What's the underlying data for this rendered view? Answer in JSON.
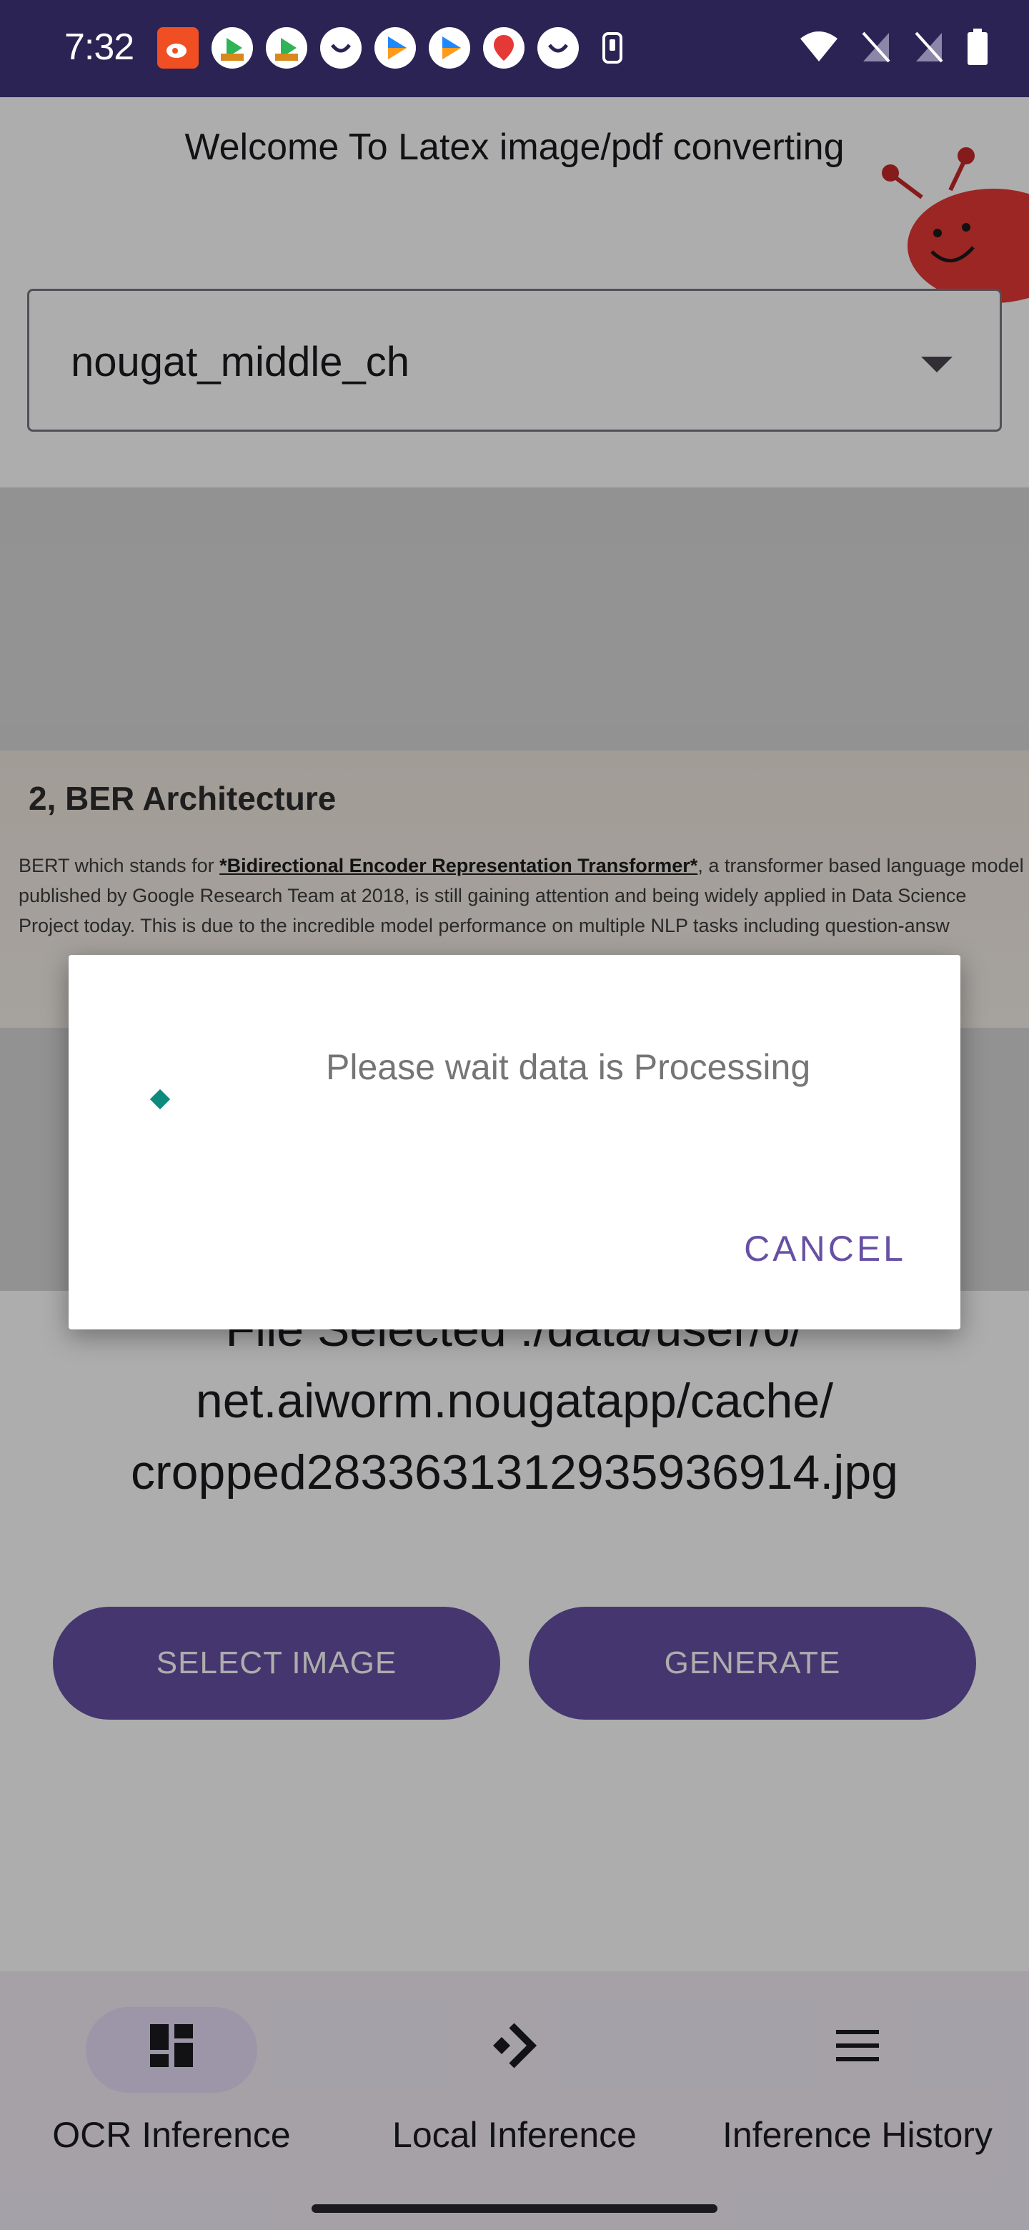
{
  "status_bar": {
    "time": "7:32",
    "notification_icons": [
      "weibo-icon",
      "video-app-icon",
      "video-app-icon",
      "taobao-icon",
      "play-app-icon",
      "play-app-icon",
      "map-pin-icon",
      "taobao-icon",
      "phone-icon"
    ],
    "system_icons": [
      "wifi-icon",
      "no-sim-icon",
      "no-sim-icon",
      "battery-icon"
    ]
  },
  "app": {
    "title": "Welcome To Latex image/pdf converting",
    "model_dropdown": {
      "value": "nougat_middle_ch"
    },
    "document_preview": {
      "heading": "2, BER Architecture",
      "text_before": "BERT which stands for ",
      "text_bold": "*Bidirectional Encoder Representation Transformer*",
      "text_after": ", a transformer based language model published by Google Research Team at 2018, is still gaining attention and being widely applied in Data Science Project today. This is due to the incredible model performance on multiple NLP tasks including question-answ"
    },
    "file_selected": "File Selected :/data/user/0/ net.aiworm.nougatapp/cache/ cropped2833631312935936914.jpg",
    "buttons": {
      "select_image": "SELECT IMAGE",
      "generate": "GENERATE"
    }
  },
  "bottom_nav": {
    "items": [
      {
        "label": "OCR Inference",
        "icon": "dashboard-icon",
        "active": true
      },
      {
        "label": "Local Inference",
        "icon": "arrow-right-icon",
        "active": false
      },
      {
        "label": "Inference History",
        "icon": "menu-icon",
        "active": false
      }
    ]
  },
  "dialog": {
    "message": "Please wait data is Processing",
    "cancel_label": "CANCEL"
  },
  "colors": {
    "status_bar": "#2b2354",
    "primary": "#6750a4",
    "spinner": "#0f8a7e",
    "nav_background": "#f3edf7",
    "nav_active_pill": "#e8def8"
  }
}
